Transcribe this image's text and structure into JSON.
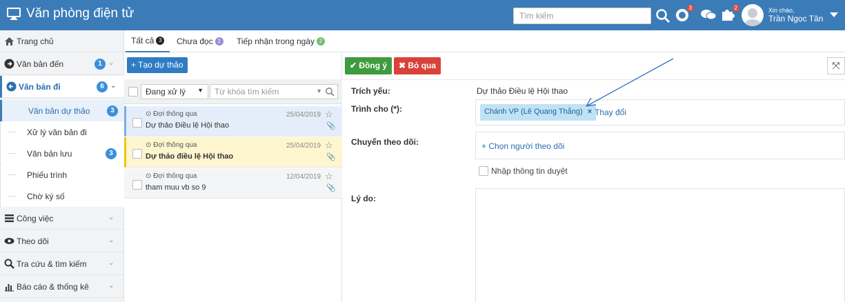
{
  "app": {
    "title": "Văn phòng điện tử"
  },
  "header": {
    "search_placeholder": "Tìm kiếm",
    "badge1": "3",
    "badge2": "2",
    "greeting": "Xin chào,",
    "user_name": "Trần Ngọc Tân"
  },
  "sidebar": {
    "home": "Trang chủ",
    "incoming": {
      "label": "Văn bản đến",
      "count": "1"
    },
    "outgoing": {
      "label": "Văn bản đi",
      "count": "6"
    },
    "sub": [
      {
        "label": "Văn bản dự thảo",
        "count": "3"
      },
      {
        "label": "Xử lý văn bản đi",
        "count": ""
      },
      {
        "label": "Văn bản lưu",
        "count": "3"
      },
      {
        "label": "Phiếu trình",
        "count": ""
      },
      {
        "label": "Chờ ký số",
        "count": ""
      }
    ],
    "work": "Công việc",
    "follow": "Theo dõi",
    "search": "Tra cứu & tìm kiếm",
    "reports": "Báo cáo & thống kê"
  },
  "tabs": [
    {
      "label": "Tất cả",
      "count": "3"
    },
    {
      "label": "Chưa đọc",
      "count": "1"
    },
    {
      "label": "Tiếp nhận trong ngày",
      "count": "2"
    }
  ],
  "list": {
    "create_label": "+ Tạo dự thảo",
    "filter_value": "Đang xử lý",
    "keyword_placeholder": "Từ khóa tìm kiếm",
    "items": [
      {
        "status": "Đợi thông qua",
        "title": "Dự thảo Điều lệ Hội thao",
        "date": "25/04/2019"
      },
      {
        "status": "Đợi thông qua",
        "title": "Dự thảo điều lệ Hội thao",
        "date": "25/04/2019"
      },
      {
        "status": "Đợi thông qua",
        "title": "tham muu vb so 9",
        "date": "12/04/2019"
      }
    ]
  },
  "detail": {
    "approve_label": "✔ Đồng ý",
    "skip_label": "✖ Bỏ qua",
    "trich_yeu_label": "Trích yếu:",
    "trich_yeu_value": "Dự thảo Điều lệ Hội thao",
    "trinh_cho_label": "Trình cho (*):",
    "recipient_tag": "Chánh VP (Lê Quang Thắng)",
    "change_label": "Thay đổi",
    "chuyen_label": "Chuyển theo dõi:",
    "choose_follower": "+ Chọn người theo dõi",
    "approve_info_label": "Nhập thông tin duyệt",
    "reason_label": "Lý do:"
  },
  "colors": {
    "topbar": "#3b7cb8",
    "accent": "#2f7cc4",
    "approve": "#3e9b3e",
    "skip": "#d9423a",
    "highlight": "#fdf6cf",
    "selected": "#e4eefa"
  }
}
